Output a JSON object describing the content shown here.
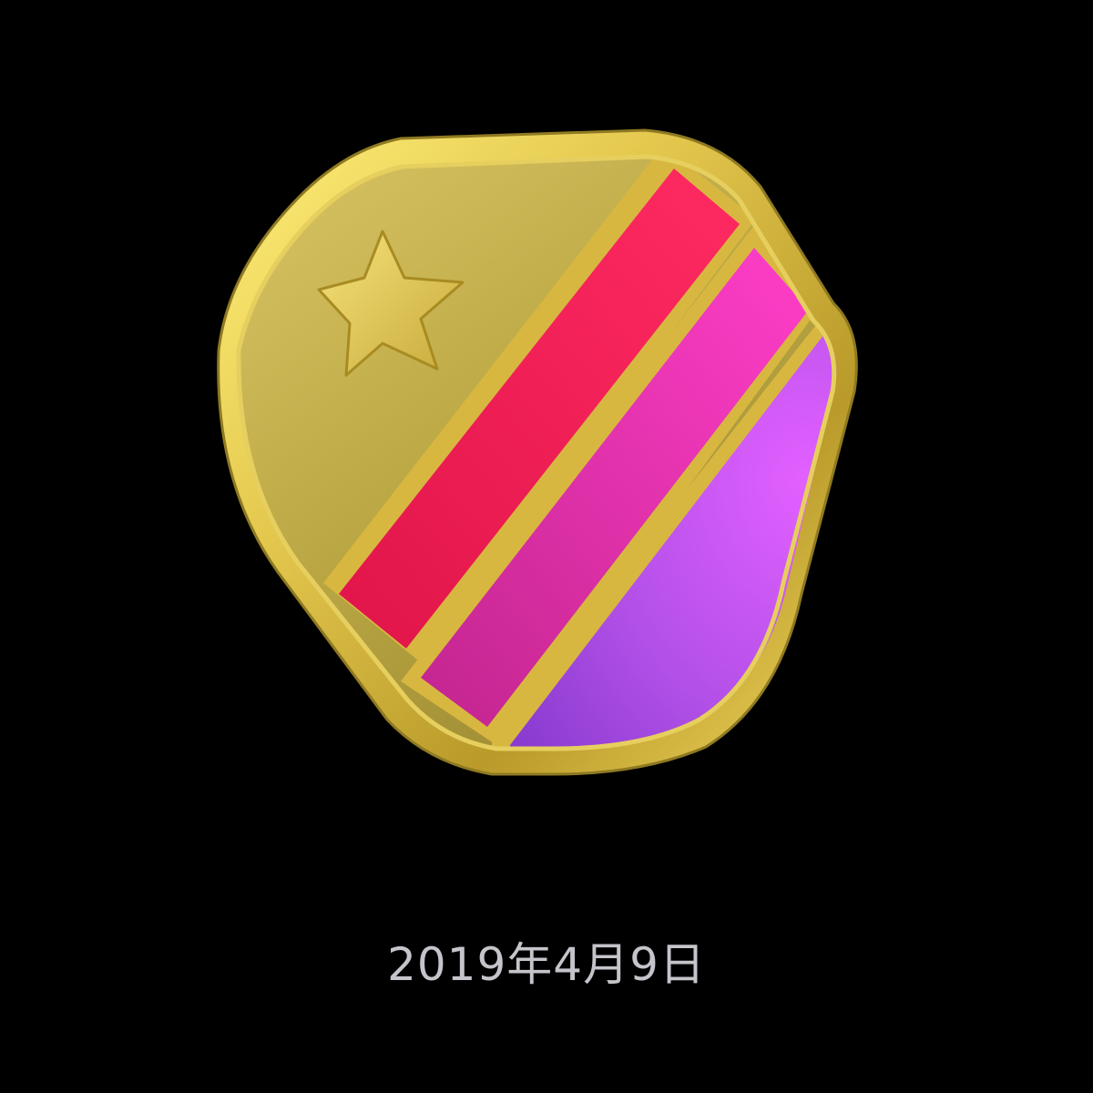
{
  "award": {
    "date": "2019年4月9日",
    "badge_icon": "shield-star-stripes-icon"
  },
  "colors": {
    "background": "#000000",
    "gold": "#c9b045",
    "stripe_red": "#ff1d57",
    "stripe_pink": "#ea2cb4",
    "stripe_purple": "#c050f0",
    "date_text": "#c4c4ca"
  }
}
